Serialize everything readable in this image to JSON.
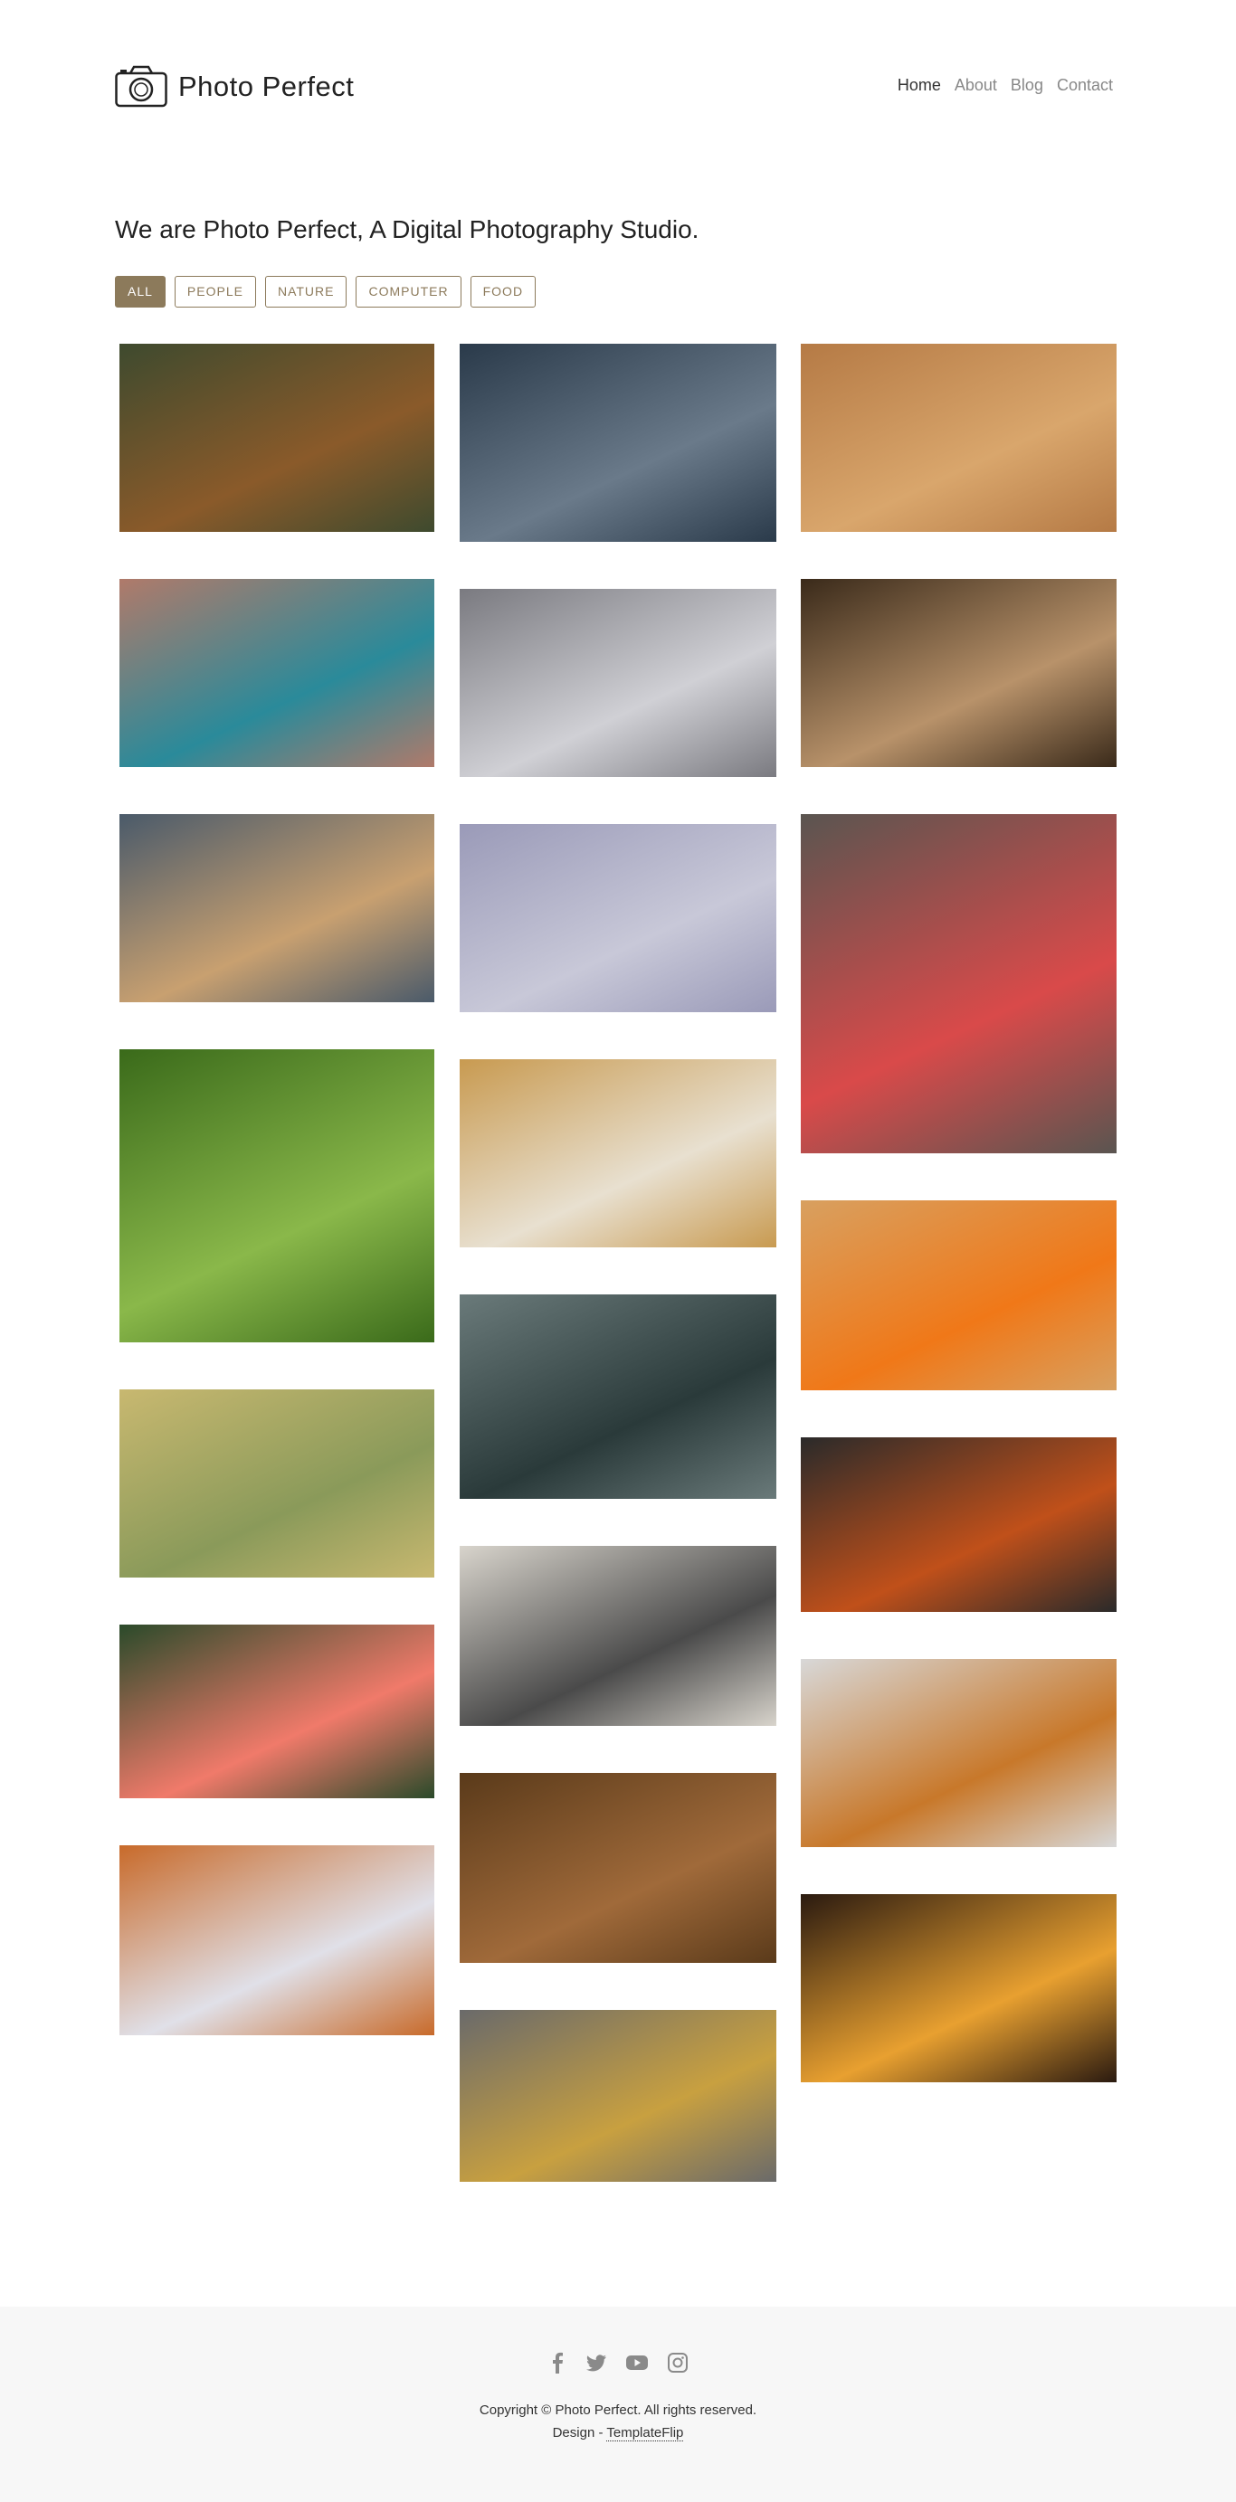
{
  "header": {
    "brand": "Photo Perfect",
    "nav": [
      "Home",
      "About",
      "Blog",
      "Contact"
    ]
  },
  "hero": {
    "headline": "We are Photo Perfect, A Digital Photography Studio."
  },
  "filters": [
    "ALL",
    "PEOPLE",
    "NATURE",
    "COMPUTER",
    "FOOD"
  ],
  "active_filter": "ALL",
  "colors": {
    "accent": "#8c7a5b",
    "footer_bg": "#f7f7f7"
  },
  "gallery": [
    {
      "name": "child-in-autumn-forest",
      "category": "nature"
    },
    {
      "name": "two-children-holding-hands",
      "category": "people"
    },
    {
      "name": "laptop-on-wooden-desk",
      "category": "computer"
    },
    {
      "name": "bird-on-hand",
      "category": "nature"
    },
    {
      "name": "people-walking-on-street",
      "category": "people"
    },
    {
      "name": "laptop-and-phone-on-desk",
      "category": "computer"
    },
    {
      "name": "person-on-beach-at-sunset",
      "category": "nature"
    },
    {
      "name": "woman-with-red-balloon",
      "category": "people"
    },
    {
      "name": "fruit-salad-in-heart-bowl",
      "category": "food"
    },
    {
      "name": "woman-with-umbrella-on-tree-lined-road",
      "category": "nature"
    },
    {
      "name": "woman-playing-guitar",
      "category": "people"
    },
    {
      "name": "peeled-mandarin-oranges",
      "category": "food"
    },
    {
      "name": "two-girls-in-water-with-leaf",
      "category": "people"
    },
    {
      "name": "tea-pot-and-cups",
      "category": "food"
    },
    {
      "name": "bird-and-red-berries",
      "category": "nature"
    },
    {
      "name": "laptop-with-tablet-and-headphones",
      "category": "computer"
    },
    {
      "name": "tagliatelle-pasta",
      "category": "food"
    },
    {
      "name": "pink-hibiscus-flower",
      "category": "nature"
    },
    {
      "name": "laptop-on-wooden-table",
      "category": "computer"
    },
    {
      "name": "burger-with-fries-and-salad",
      "category": "food"
    },
    {
      "name": "woman-sitting-in-autumn-leaves",
      "category": "people"
    },
    {
      "name": "laptop-on-desk-top-view",
      "category": "computer"
    }
  ],
  "footer": {
    "social": [
      "facebook-icon",
      "twitter-icon",
      "youtube-icon",
      "instagram-icon"
    ],
    "copyright": "Copyright © Photo Perfect. All rights reserved.",
    "design_prefix": "Design - ",
    "design_link": "TemplateFlip"
  }
}
